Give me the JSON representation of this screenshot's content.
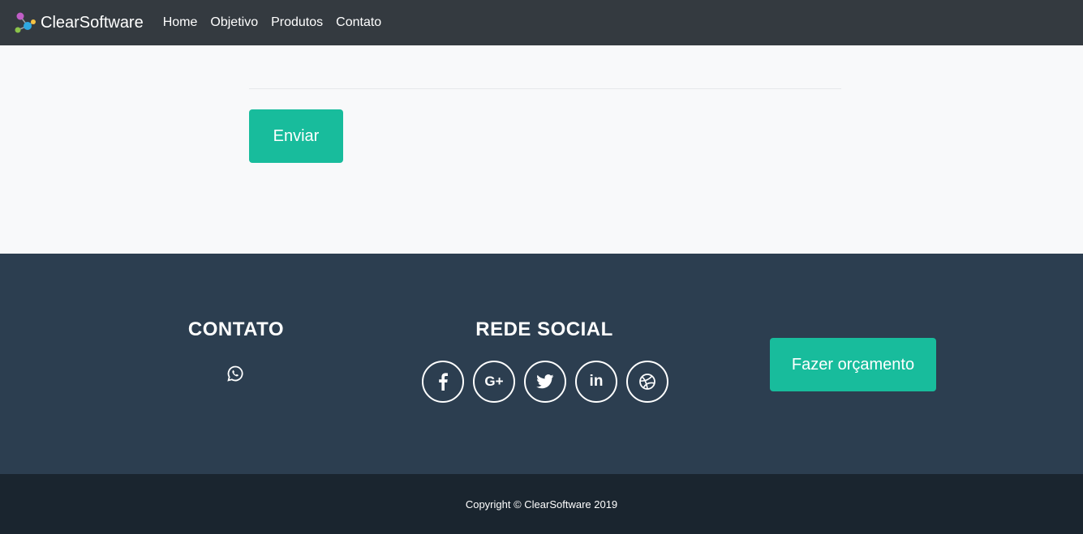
{
  "navbar": {
    "brand": "ClearSoftware",
    "links": [
      "Home",
      "Objetivo",
      "Produtos",
      "Contato"
    ]
  },
  "form": {
    "submit_label": "Enviar"
  },
  "footer": {
    "contato_heading": "CONTATO",
    "social_heading": "REDE SOCIAL",
    "social_icons": [
      "facebook-icon",
      "google-plus-icon",
      "twitter-icon",
      "linkedin-icon",
      "dribbble-icon"
    ],
    "social_glyphs": {
      "google_plus": "G+",
      "linkedin": "in"
    },
    "quote_label": "Fazer orçamento"
  },
  "copyright": "Copyright © ClearSoftware 2019",
  "colors": {
    "navbar": "#343a40",
    "accent": "#18bc9c",
    "footer": "#2c3e50",
    "copyright_bar": "#1a252f"
  }
}
